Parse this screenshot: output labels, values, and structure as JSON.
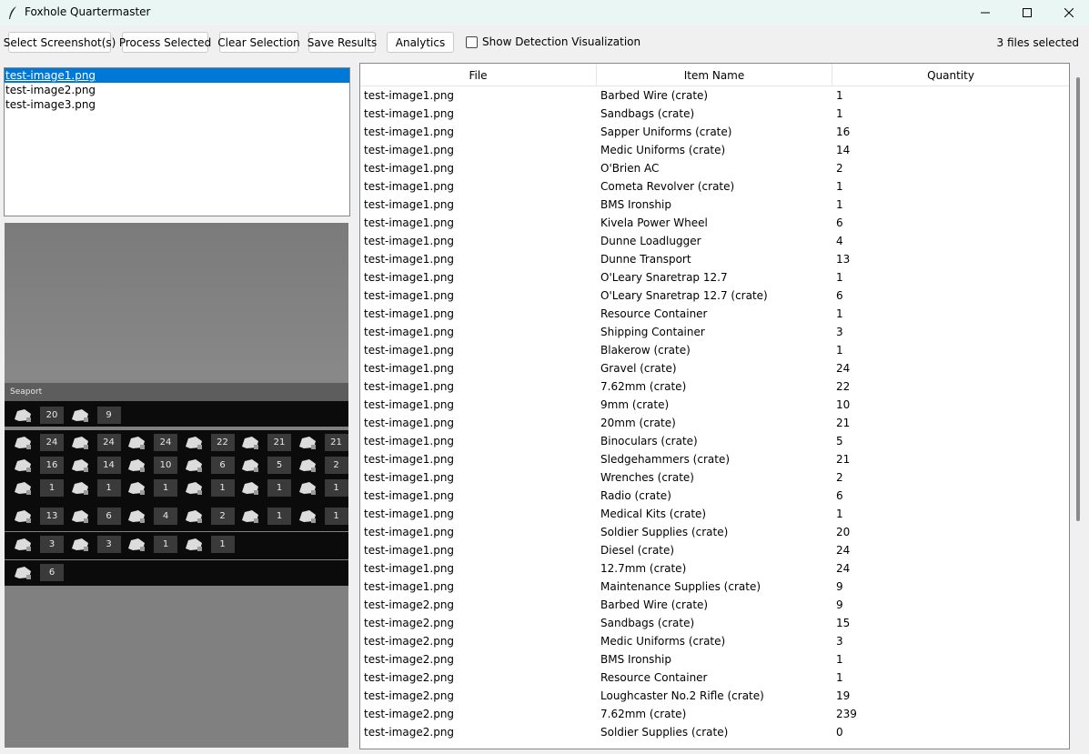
{
  "window": {
    "title": "Foxhole Quartermaster",
    "controls": [
      "minimize-icon",
      "maximize-icon",
      "close-icon"
    ]
  },
  "toolbar": {
    "select_label": "Select Screenshot(s)",
    "process_label": "Process Selected",
    "clear_label": "Clear Selection",
    "save_label": "Save Results",
    "analytics_label": "Analytics",
    "viz_label": "Show Detection Visualization",
    "viz_checked": false,
    "status": "3 files selected"
  },
  "file_list": [
    "test-image1.png",
    "test-image2.png",
    "test-image3.png"
  ],
  "selected_file_index": 0,
  "preview": {
    "section_label": "Seaport",
    "rows": [
      [
        {
          "icon": "crate-icon",
          "qty": "20"
        },
        {
          "icon": "soldier-icon",
          "qty": "9"
        }
      ],
      [
        {
          "icon": "uniform-icon",
          "qty": "24"
        },
        {
          "icon": "barbed-wire-icon",
          "qty": "24"
        },
        {
          "icon": "sandbag-icon",
          "qty": "24"
        },
        {
          "icon": "ammo-icon",
          "qty": "22"
        },
        {
          "icon": "ammo-box-icon",
          "qty": "21"
        },
        {
          "icon": "sledgehammer-icon",
          "qty": "21"
        }
      ],
      [
        {
          "icon": "medic-uniform-icon",
          "qty": "16"
        },
        {
          "icon": "sapper-uniform-icon",
          "qty": "14"
        },
        {
          "icon": "rifle-icon",
          "qty": "10"
        },
        {
          "icon": "revolver-icon",
          "qty": "6"
        },
        {
          "icon": "binoculars-icon",
          "qty": "5"
        },
        {
          "icon": "wrench-icon",
          "qty": "2"
        }
      ],
      [
        {
          "icon": "smg-icon",
          "qty": "1"
        },
        {
          "icon": "helmet-icon",
          "qty": "1"
        },
        {
          "icon": "knife-icon",
          "qty": "1"
        },
        {
          "icon": "pistol-icon",
          "qty": "1"
        },
        {
          "icon": "grenade-icon",
          "qty": "1"
        },
        {
          "icon": "radio-icon",
          "qty": "1"
        }
      ],
      [
        {
          "icon": "truck-icon",
          "qty": "13"
        },
        {
          "icon": "car-icon",
          "qty": "6"
        },
        {
          "icon": "transport-icon",
          "qty": "4"
        },
        {
          "icon": "loadlugger-icon",
          "qty": "2"
        },
        {
          "icon": "power-wheel-icon",
          "qty": "1"
        },
        {
          "icon": "ac-icon",
          "qty": "1"
        }
      ],
      [
        {
          "icon": "container-icon",
          "qty": "3"
        },
        {
          "icon": "ironship-icon",
          "qty": "3"
        },
        {
          "icon": "shipping-container-icon",
          "qty": "1"
        },
        {
          "icon": "gun-emplacement-icon",
          "qty": "1"
        }
      ],
      [
        {
          "icon": "snaretrap-icon",
          "qty": "6"
        }
      ]
    ]
  },
  "table": {
    "columns": [
      "File",
      "Item Name",
      "Quantity"
    ],
    "rows": [
      [
        "test-image1.png",
        "Barbed Wire (crate)",
        "1"
      ],
      [
        "test-image1.png",
        "Sandbags (crate)",
        "1"
      ],
      [
        "test-image1.png",
        "Sapper Uniforms (crate)",
        "16"
      ],
      [
        "test-image1.png",
        "Medic Uniforms (crate)",
        "14"
      ],
      [
        "test-image1.png",
        "O'Brien AC",
        "2"
      ],
      [
        "test-image1.png",
        "Cometa Revolver (crate)",
        "1"
      ],
      [
        "test-image1.png",
        "BMS Ironship",
        "1"
      ],
      [
        "test-image1.png",
        "Kivela Power Wheel",
        "6"
      ],
      [
        "test-image1.png",
        "Dunne Loadlugger",
        "4"
      ],
      [
        "test-image1.png",
        "Dunne Transport",
        "13"
      ],
      [
        "test-image1.png",
        "O'Leary Snaretrap 12.7",
        "1"
      ],
      [
        "test-image1.png",
        "O'Leary Snaretrap 12.7 (crate)",
        "6"
      ],
      [
        "test-image1.png",
        "Resource Container",
        "1"
      ],
      [
        "test-image1.png",
        "Shipping Container",
        "3"
      ],
      [
        "test-image1.png",
        "Blakerow (crate)",
        "1"
      ],
      [
        "test-image1.png",
        "Gravel (crate)",
        "24"
      ],
      [
        "test-image1.png",
        "7.62mm (crate)",
        "22"
      ],
      [
        "test-image1.png",
        "9mm (crate)",
        "10"
      ],
      [
        "test-image1.png",
        "20mm (crate)",
        "21"
      ],
      [
        "test-image1.png",
        "Binoculars (crate)",
        "5"
      ],
      [
        "test-image1.png",
        "Sledgehammers (crate)",
        "21"
      ],
      [
        "test-image1.png",
        "Wrenches (crate)",
        "2"
      ],
      [
        "test-image1.png",
        "Radio (crate)",
        "6"
      ],
      [
        "test-image1.png",
        "Medical Kits (crate)",
        "1"
      ],
      [
        "test-image1.png",
        "Soldier Supplies (crate)",
        "20"
      ],
      [
        "test-image1.png",
        "Diesel (crate)",
        "24"
      ],
      [
        "test-image1.png",
        "12.7mm (crate)",
        "24"
      ],
      [
        "test-image1.png",
        "Maintenance Supplies (crate)",
        "9"
      ],
      [
        "test-image2.png",
        "Barbed Wire (crate)",
        "9"
      ],
      [
        "test-image2.png",
        "Sandbags (crate)",
        "15"
      ],
      [
        "test-image2.png",
        "Medic Uniforms (crate)",
        "3"
      ],
      [
        "test-image2.png",
        "BMS Ironship",
        "1"
      ],
      [
        "test-image2.png",
        "Resource Container",
        "1"
      ],
      [
        "test-image2.png",
        "Loughcaster No.2 Rifle (crate)",
        "19"
      ],
      [
        "test-image2.png",
        "7.62mm (crate)",
        "239"
      ],
      [
        "test-image2.png",
        "Soldier Supplies (crate)",
        "0"
      ]
    ]
  }
}
